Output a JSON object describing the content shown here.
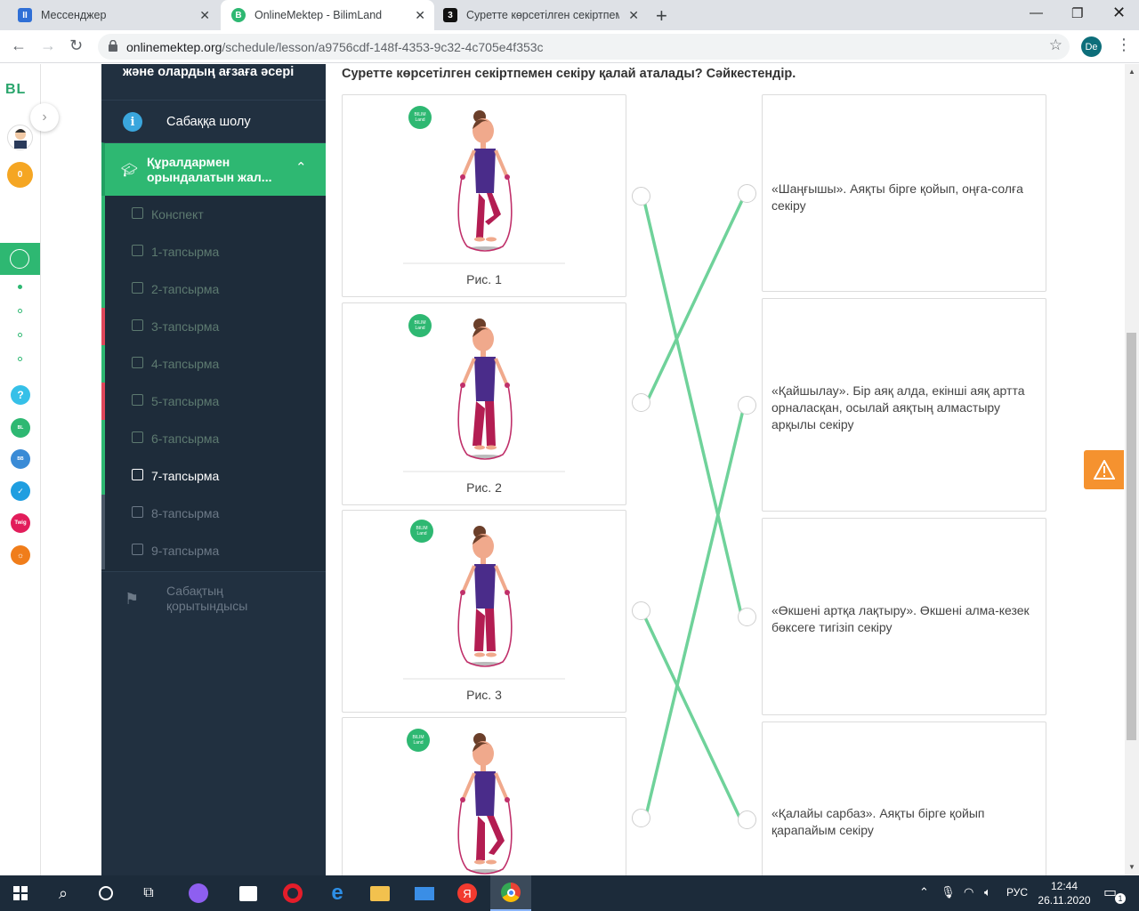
{
  "browser": {
    "tabs": [
      {
        "title": "Мессенджер",
        "icon": "messenger-icon",
        "color": "#2f6fd6",
        "glyph": "II"
      },
      {
        "title": "OnlineMektep - BilimLand",
        "icon": "bilimland-icon",
        "color": "#2eb872",
        "glyph": "B"
      },
      {
        "title": "Суретте көрсетілген секіртпеме",
        "icon": "znanija-icon",
        "color": "#111111",
        "glyph": "3"
      }
    ],
    "url_host": "onlinemektep.org",
    "url_path": "/schedule/lesson/a9756cdf-148f-4353-9c32-4c705e4f353c",
    "profile_initials": "De"
  },
  "rail": {
    "logo": "BL",
    "coins": "0"
  },
  "sidebar": {
    "unit_title": "және олардың ағзаға әсері",
    "overview": "Сабаққа шолу",
    "section": "Құралдармен орындалатын жал...",
    "items": [
      {
        "label": "Конспект",
        "color": "#5d7a70",
        "bar": "#2eb872"
      },
      {
        "label": "1-тапсырма",
        "color": "#5d7a70",
        "bar": "#2eb872"
      },
      {
        "label": "2-тапсырма",
        "color": "#5d7a70",
        "bar": "#2eb872"
      },
      {
        "label": "3-тапсырма",
        "color": "#5d7a70",
        "bar": "#e0475b"
      },
      {
        "label": "4-тапсырма",
        "color": "#5d7a70",
        "bar": "#2eb872"
      },
      {
        "label": "5-тапсырма",
        "color": "#5d7a70",
        "bar": "#e0475b"
      },
      {
        "label": "6-тапсырма",
        "color": "#5d7a70",
        "bar": "#2eb872"
      },
      {
        "label": "7-тапсырма",
        "color": "#ffffff",
        "bar": "#2eb872"
      },
      {
        "label": "8-тапсырма",
        "color": "#6c7987",
        "bar": "#4a5867"
      },
      {
        "label": "9-тапсырма",
        "color": "#6c7987",
        "bar": "#4a5867"
      }
    ],
    "summary": "Сабақтың қорытындысы"
  },
  "task": {
    "question": "Суретте көрсетілген секіртпемен секіру қалай аталады? Сәйкестендір.",
    "pictures": [
      {
        "caption": "Рис. 1"
      },
      {
        "caption": "Рис. 2"
      },
      {
        "caption": "Рис. 3"
      },
      {
        "caption": ""
      }
    ],
    "answers": [
      "«Шаңғышы». Аяқты бірге қойып, оңға-солға секіру",
      "«Қайшылау». Бір аяқ алда, екінші аяқ артта орналасқан, осылай аяқтың алмастыру арқылы секіру",
      "«Өкшені артқа лақтыру». Өкшені алма-кезек бөксеге тигізіп секіру",
      "«Қалайы сарбаз». Аяқты бірге қойып қарапайым секіру"
    ],
    "matches": [
      [
        1,
        3
      ],
      [
        2,
        1
      ],
      [
        3,
        4
      ],
      [
        4,
        2
      ]
    ],
    "line_color": "#6fd29a"
  },
  "taskbar": {
    "lang": "РУС",
    "time": "12:44",
    "date": "26.11.2020",
    "notifications": "1"
  }
}
